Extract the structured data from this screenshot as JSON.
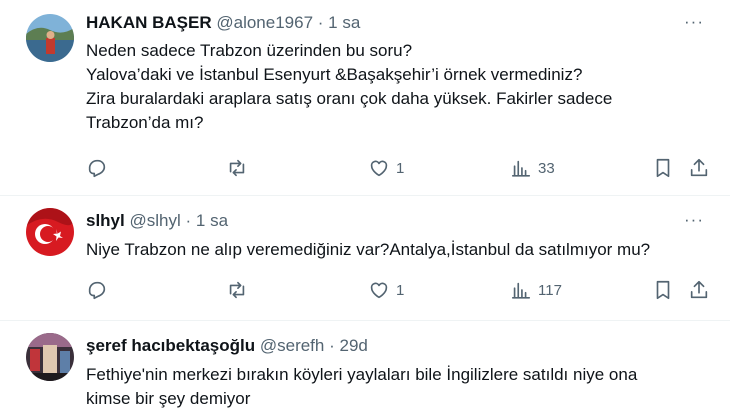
{
  "tweets": [
    {
      "name": "HAKAN BAŞER",
      "handle": "@alone1967",
      "separator": "·",
      "time": "1 sa",
      "more": "···",
      "lines": [
        "Neden sadece Trabzon üzerinden bu soru?",
        "Yalova’daki ve İstanbul Esenyurt  &Başakşehir’i örnek vermediniz?",
        "Zira buralardaki araplara satış oranı çok daha yüksek. Fakirler sadece",
        "Trabzon’da mı?"
      ],
      "replies": "",
      "retweets": "",
      "likes": "1",
      "views": "33"
    },
    {
      "name": "slhyl",
      "handle": "@slhyl",
      "separator": "·",
      "time": "1 sa",
      "more": "···",
      "lines": [
        "Niye Trabzon ne alıp veremediğiniz var?Antalya,İstanbul da satılmıyor mu?"
      ],
      "replies": "",
      "retweets": "",
      "likes": "1",
      "views": "117"
    },
    {
      "name": "şeref hacıbektaşoğlu",
      "handle": "@serefh",
      "separator": "·",
      "time": "29d",
      "more": "···",
      "lines": [
        "Fethiye'nin merkezi bırakın köyleri yaylaları bile İngilizlere satıldı niye ona",
        "kimse bir şey demiyor"
      ]
    }
  ],
  "colors": {
    "text": "#0f1419",
    "secondary": "#536471",
    "divider": "#eff3f4"
  },
  "icons": [
    "reply-icon",
    "retweet-icon",
    "like-icon",
    "views-icon",
    "bookmark-icon",
    "share-icon",
    "more-icon"
  ]
}
